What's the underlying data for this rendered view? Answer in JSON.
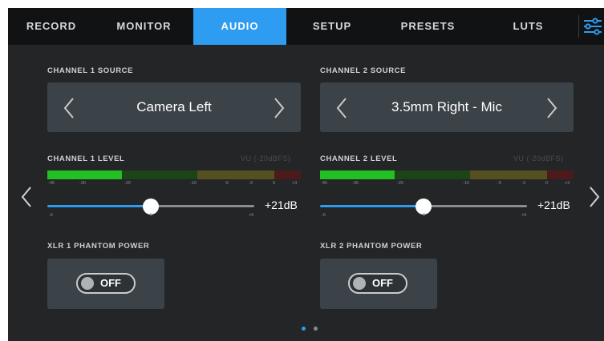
{
  "tabs": [
    "RECORD",
    "MONITOR",
    "AUDIO",
    "SETUP",
    "PRESETS",
    "LUTS"
  ],
  "active_tab": "AUDIO",
  "channel1": {
    "source_label": "CHANNEL 1 SOURCE",
    "source_value": "Camera Left",
    "level_label": "CHANNEL 1 LEVEL",
    "vu_label": "VU (-20dBFS)",
    "meter_fraction": 0.29,
    "meter_scale": [
      "-45",
      "-30",
      "-20",
      "-10",
      "-6",
      "-3",
      "0",
      "+3"
    ],
    "slider_scale_min": "-6",
    "slider_scale_mid": "0",
    "slider_scale_max": "+6",
    "slider_fraction": 0.5,
    "gain_value": "+21dB",
    "phantom_label": "XLR 1 PHANTOM POWER",
    "phantom_state": "OFF"
  },
  "channel2": {
    "source_label": "CHANNEL 2 SOURCE",
    "source_value": "3.5mm Right - Mic",
    "level_label": "CHANNEL 2 LEVEL",
    "vu_label": "VU (-20dBFS)",
    "meter_fraction": 0.29,
    "meter_scale": [
      "-45",
      "-30",
      "-20",
      "-10",
      "-6",
      "-3",
      "0",
      "+3"
    ],
    "slider_scale_min": "-6",
    "slider_scale_mid": "0",
    "slider_scale_max": "+6",
    "slider_fraction": 0.5,
    "gain_value": "+21dB",
    "phantom_label": "XLR 2 PHANTOM POWER",
    "phantom_state": "OFF"
  },
  "page_indicator": {
    "current": 1,
    "total": 2
  },
  "colors": {
    "accent": "#2e9cf0",
    "tabbar": "#111213",
    "panel": "#232527",
    "control": "#3b4248",
    "meter_green": "#22c022",
    "meter_green_dim": "#1d4419",
    "meter_yellow_dim": "#54501f",
    "meter_red_dim": "#4d1a1c"
  },
  "icons": {
    "settings": "sliders-icon",
    "prev": "chevron-left-icon",
    "next": "chevron-right-icon"
  }
}
